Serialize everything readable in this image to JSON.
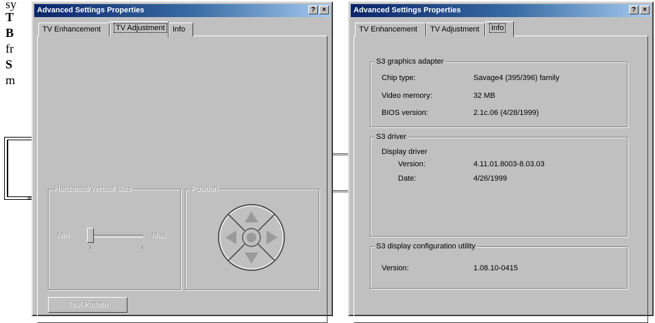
{
  "background_document": {
    "line1": "sy",
    "line2_bold": "T",
    "line3_bold": "B",
    "line4": "fr",
    "line5_bold": "S",
    "line6": "m"
  },
  "left_window": {
    "title": "Advanced Settings Properties",
    "help_button": "?",
    "close_button": "×",
    "tabs": [
      "TV Enhancement",
      "TV Adjustment",
      "Info"
    ],
    "active_tab": "TV Adjustment",
    "size_group": {
      "label": "Horizontal/Vertical Size",
      "min_label": "Min",
      "max_label": "Max"
    },
    "position_group": {
      "label": "Position"
    },
    "test_button": "Test Pattern"
  },
  "right_window": {
    "title": "Advanced Settings Properties",
    "help_button": "?",
    "close_button": "×",
    "tabs": [
      "TV Enhancement",
      "TV Adjustment",
      "Info"
    ],
    "active_tab": "Info",
    "adapter": {
      "label": "S3 graphics adapter",
      "chip_type_label": "Chip type:",
      "chip_type_value": "Savage4 (395/396) family",
      "video_memory_label": "Video memory:",
      "video_memory_value": "32 MB",
      "bios_label": "BIOS version:",
      "bios_value": "2.1c.06 (4/28/1999)"
    },
    "driver": {
      "label": "S3 driver",
      "display_driver_label": "Display driver",
      "version_label": "Version:",
      "version_value": "4.11.01.8003-8.03.03",
      "date_label": "Date:",
      "date_value": "4/26/1999"
    },
    "utility": {
      "label": "S3 display configuration utility",
      "version_label": "Version:",
      "version_value": "1.08.10-0415"
    }
  }
}
